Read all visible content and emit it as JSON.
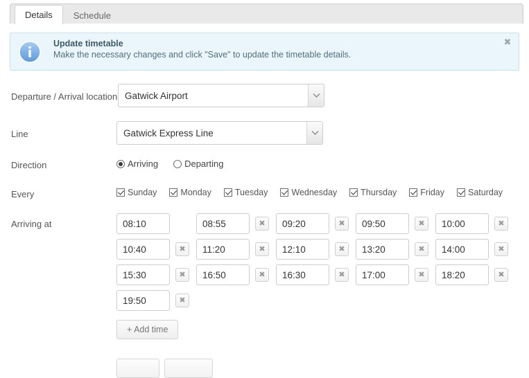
{
  "tabs": [
    {
      "label": "Details",
      "active": true
    },
    {
      "label": "Schedule",
      "active": false
    }
  ],
  "alert": {
    "icon": "info-icon",
    "title": "Update timetable",
    "message": "Make the necessary changes and click \"Save\" to update the timetable details.",
    "close_label": "✖",
    "bg_color": "#eaf6fb",
    "border_color": "#c5e3ef",
    "icon_color": "#6aa8e0"
  },
  "form": {
    "location": {
      "label": "Departure / Arrival location",
      "value": "Gatwick Airport",
      "arrow_icon": "chevron-down-icon"
    },
    "line": {
      "label": "Line",
      "value": "Gatwick Express Line",
      "arrow_icon": "chevron-down-icon"
    },
    "direction": {
      "label": "Direction",
      "options": [
        {
          "label": "Arriving",
          "checked": true
        },
        {
          "label": "Departing",
          "checked": false
        }
      ]
    },
    "every": {
      "label": "Every",
      "days": [
        {
          "label": "Sunday",
          "checked": true
        },
        {
          "label": "Monday",
          "checked": true
        },
        {
          "label": "Tuesday",
          "checked": true
        },
        {
          "label": "Wednesday",
          "checked": true
        },
        {
          "label": "Thursday",
          "checked": true
        },
        {
          "label": "Friday",
          "checked": true
        },
        {
          "label": "Saturday",
          "checked": true
        }
      ]
    },
    "arriving_at": {
      "label": "Arriving at",
      "delete_label": "✖",
      "add_label": "+ Add time",
      "rows": [
        [
          {
            "value": "08:10",
            "deletable": false
          },
          {
            "value": "08:55",
            "deletable": true
          },
          {
            "value": "09:20",
            "deletable": true
          },
          {
            "value": "09:50",
            "deletable": true
          },
          {
            "value": "10:00",
            "deletable": true
          }
        ],
        [
          {
            "value": "10:40",
            "deletable": true
          },
          {
            "value": "11:20",
            "deletable": true
          },
          {
            "value": "12:10",
            "deletable": true
          },
          {
            "value": "13:20",
            "deletable": true
          },
          {
            "value": "14:00",
            "deletable": true
          }
        ],
        [
          {
            "value": "15:30",
            "deletable": true
          },
          {
            "value": "16:50",
            "deletable": true
          },
          {
            "value": "16:30",
            "deletable": true
          },
          {
            "value": "17:00",
            "deletable": true
          },
          {
            "value": "18:20",
            "deletable": true
          }
        ],
        [
          {
            "value": "19:50",
            "deletable": true
          }
        ]
      ]
    }
  },
  "footer": {
    "buttons": [
      {
        "label": ""
      },
      {
        "label": ""
      }
    ]
  }
}
